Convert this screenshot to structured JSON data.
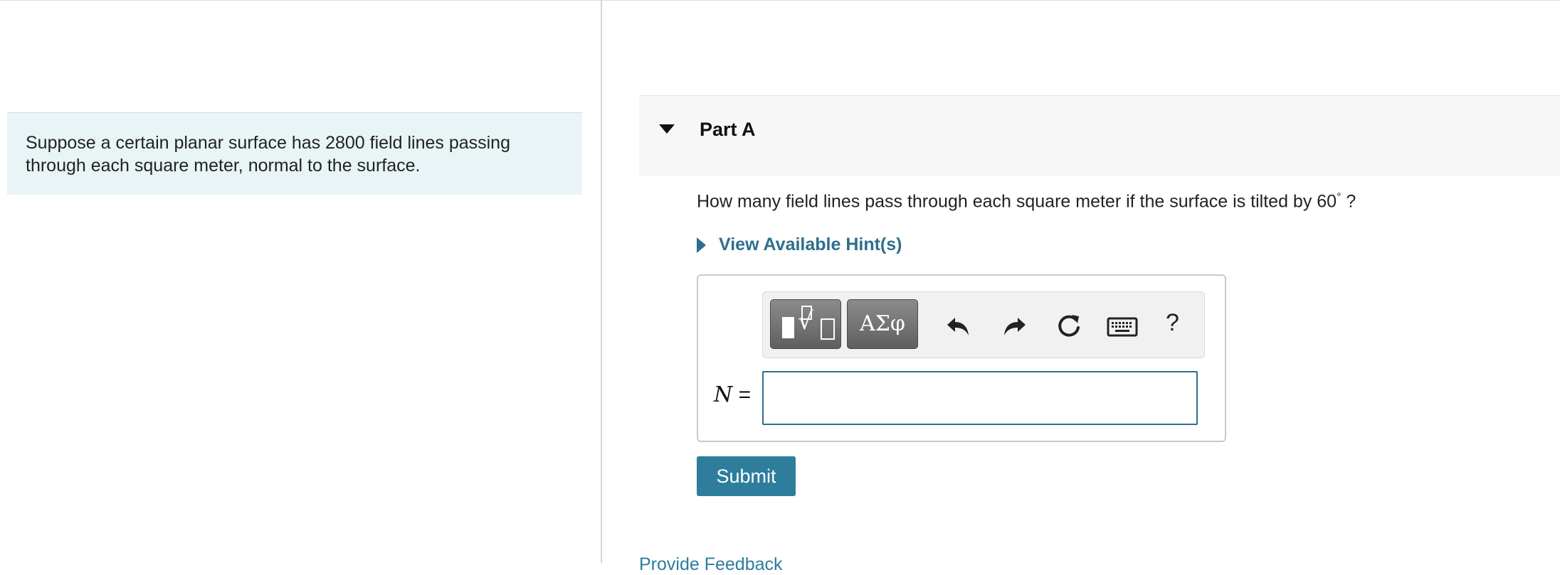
{
  "intro": {
    "text": "Suppose a certain planar surface has 2800 field lines passing through each square meter, normal to the surface."
  },
  "part": {
    "title": "Part A",
    "question_prefix": "How many field lines pass through each square meter if the surface is tilted by 60",
    "question_degree": "°",
    "question_suffix": " ?",
    "hint_label": "View Available Hint(s)"
  },
  "toolbar": {
    "greek_label": "ΑΣφ",
    "help_label": "?",
    "icons": [
      "templates-icon",
      "greek-symbols-icon",
      "undo-icon",
      "redo-icon",
      "reset-icon",
      "keyboard-icon",
      "help-icon"
    ]
  },
  "answer": {
    "variable": "N",
    "equals": "=",
    "value": ""
  },
  "submit_label": "Submit",
  "feedback_label": "Provide Feedback",
  "colors": {
    "accent": "#2e7d9c",
    "intro_bg": "#e9f4f6",
    "header_bg": "#f7f7f7"
  }
}
